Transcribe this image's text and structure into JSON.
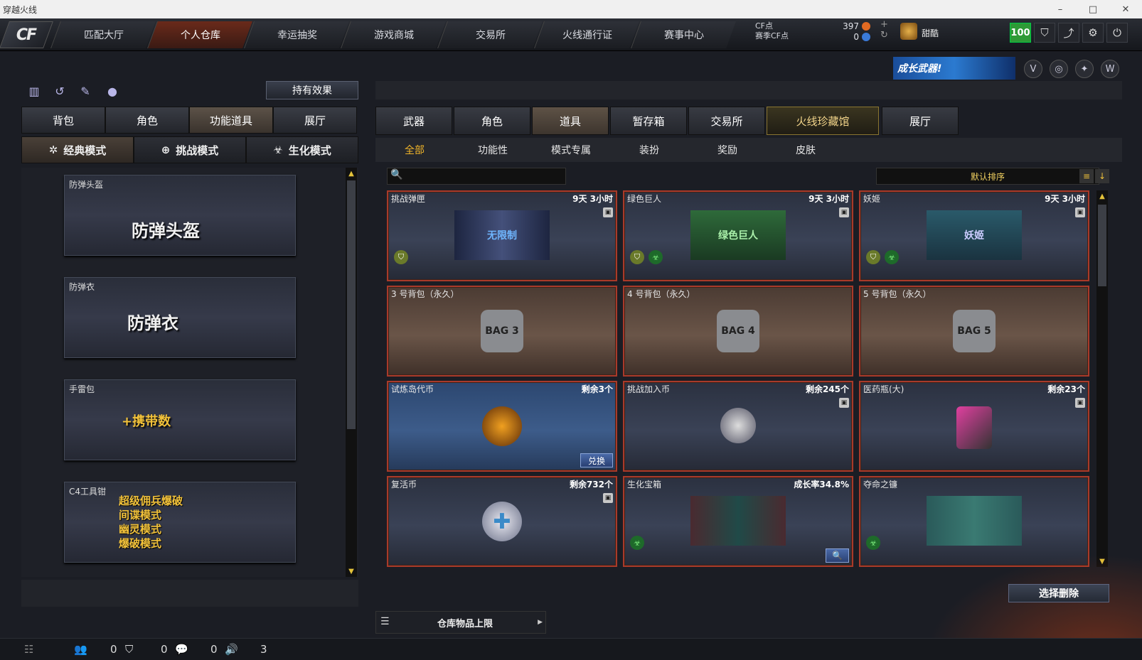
{
  "window": {
    "title": "穿越火线"
  },
  "topnav": {
    "logo": "CF",
    "tabs": [
      "匹配大厅",
      "个人仓库",
      "幸运抽奖",
      "游戏商城",
      "交易所",
      "火线通行证",
      "赛事中心"
    ],
    "active_tab": 1
  },
  "currency": {
    "cf_label": "CF点",
    "season_label": "赛季CF点",
    "cf_value": "397",
    "season_value": "0"
  },
  "user": {
    "name": "甜酷",
    "level_badge": "100"
  },
  "banner": {
    "text": "成长武器!"
  },
  "left": {
    "hold_effect": "持有效果",
    "tabs": [
      "背包",
      "角色",
      "功能道具",
      "展厅"
    ],
    "active_tab": 2,
    "modes": [
      "经典模式",
      "挑战模式",
      "生化模式"
    ],
    "items": [
      {
        "title": "防弹头盔",
        "big": "防弹头盔"
      },
      {
        "title": "防弹衣",
        "big": "防弹衣"
      },
      {
        "title": "手雷包",
        "big": "+携带数"
      },
      {
        "title": "C4工具钳",
        "lines": [
          "超级佣兵爆破",
          "间谍模式",
          "幽灵模式",
          "爆破模式"
        ]
      }
    ]
  },
  "right": {
    "tabs": [
      "武器",
      "角色",
      "道具",
      "暂存箱",
      "交易所",
      "火线珍藏馆",
      "展厅"
    ],
    "active_tab": 2,
    "subtabs": [
      "全部",
      "功能性",
      "模式专属",
      "装扮",
      "奖励",
      "皮肤"
    ],
    "active_sub": 0,
    "sort": "默认排序",
    "cards": [
      {
        "name": "挑战弹匣",
        "info": "9天 3小时",
        "img": "无限制"
      },
      {
        "name": "绿色巨人",
        "info": "9天 3小时",
        "img": "绿色巨人"
      },
      {
        "name": "妖姬",
        "info": "9天 3小时",
        "img": "妖姬"
      },
      {
        "name": "3 号背包（永久）",
        "info": "",
        "img": "BAG 3"
      },
      {
        "name": "4 号背包（永久）",
        "info": "",
        "img": "BAG 4"
      },
      {
        "name": "5 号背包（永久）",
        "info": "",
        "img": "BAG 5"
      },
      {
        "name": "试炼岛代币",
        "info": "剩余3个",
        "img": "",
        "action": "兑换"
      },
      {
        "name": "挑战加入币",
        "info": "剩余245个",
        "img": ""
      },
      {
        "name": "医药瓶(大)",
        "info": "剩余23个",
        "img": ""
      },
      {
        "name": "复活币",
        "info": "剩余732个",
        "img": ""
      },
      {
        "name": "生化宝箱",
        "info": "成长率34.8%",
        "img": ""
      },
      {
        "name": "夺命之镰",
        "info": "",
        "img": ""
      }
    ],
    "delete_button": "选择删除",
    "storage_label": "仓库物品上限"
  },
  "statusbar": {
    "v1": "0",
    "v2": "0",
    "v3": "0",
    "v4": "3"
  }
}
